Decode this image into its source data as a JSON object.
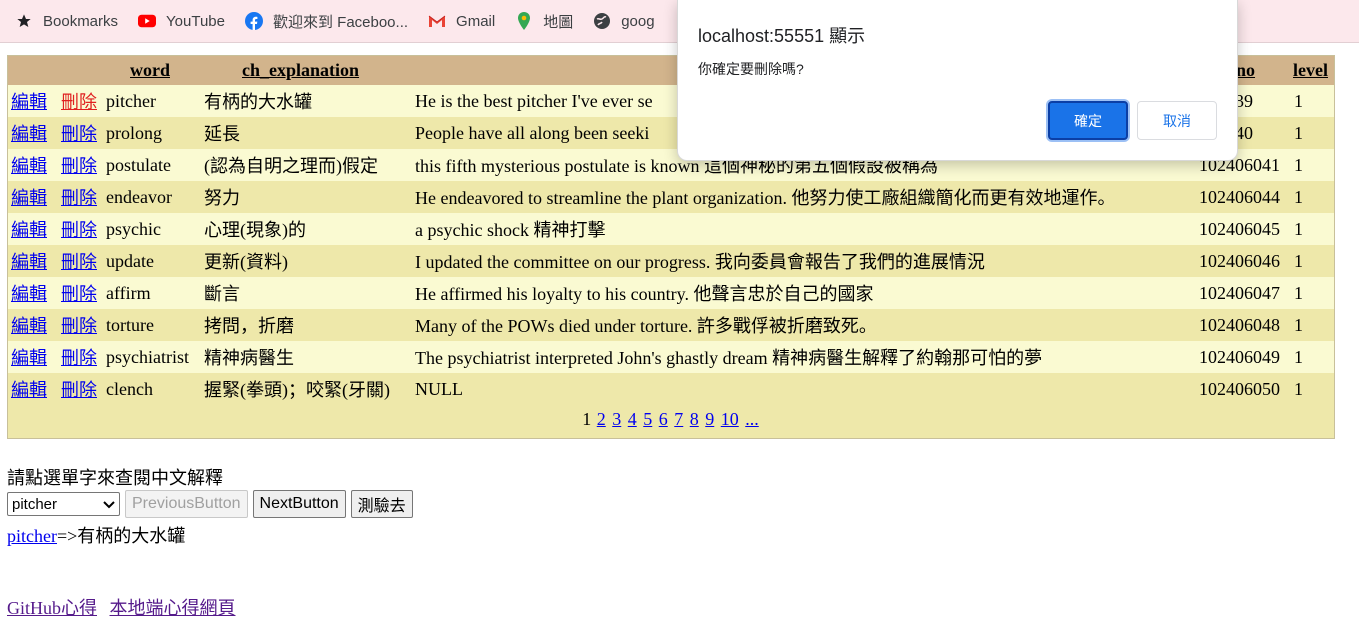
{
  "bookmarks": [
    {
      "label": "Bookmarks",
      "icon": "star-icon"
    },
    {
      "label": "YouTube",
      "icon": "youtube-icon"
    },
    {
      "label": "歡迎來到 Faceboo...",
      "icon": "facebook-icon"
    },
    {
      "label": "Gmail",
      "icon": "gmail-icon"
    },
    {
      "label": "地圖",
      "icon": "maps-icon"
    },
    {
      "label": "goog",
      "icon": "globe-icon"
    }
  ],
  "table": {
    "headers": {
      "word": "word",
      "ch_explanation": "ch_explanation",
      "no": "no",
      "level": "level"
    },
    "edit_label": "編輯",
    "delete_label": "刪除",
    "rows": [
      {
        "word": "pitcher",
        "ch": "有柄的大水罐",
        "sentence": "He is the best pitcher I've ever se",
        "no": "406039",
        "level": "1"
      },
      {
        "word": "prolong",
        "ch": "延長",
        "sentence": "People have all along been seeki",
        "no": "406040",
        "level": "1"
      },
      {
        "word": "postulate",
        "ch": "(認為自明之理而)假定",
        "sentence": "this fifth mysterious postulate is known 這個神秘的第五個假設被稱為",
        "no": "102406041",
        "level": "1"
      },
      {
        "word": "endeavor",
        "ch": "努力",
        "sentence": "He endeavored to streamline the plant organization. 他努力使工廠組織簡化而更有效地運作。",
        "no": "102406044",
        "level": "1"
      },
      {
        "word": "psychic",
        "ch": "心理(現象)的",
        "sentence": "a psychic shock 精神打擊",
        "no": "102406045",
        "level": "1"
      },
      {
        "word": "update",
        "ch": "更新(資料)",
        "sentence": "I updated the committee on our progress. 我向委員會報告了我們的進展情況",
        "no": "102406046",
        "level": "1"
      },
      {
        "word": "affirm",
        "ch": "斷言",
        "sentence": "He affirmed his loyalty to his country. 他聲言忠於自己的國家",
        "no": "102406047",
        "level": "1"
      },
      {
        "word": "torture",
        "ch": "拷問，折磨",
        "sentence": "Many of the POWs died under torture. 許多戰俘被折磨致死。",
        "no": "102406048",
        "level": "1"
      },
      {
        "word": "psychiatrist",
        "ch": "精神病醫生",
        "sentence": "The psychiatrist interpreted John's ghastly dream 精神病醫生解釋了約翰那可怕的夢",
        "no": "102406049",
        "level": "1"
      },
      {
        "word": "clench",
        "ch": "握緊(拳頭)；咬緊(牙關)",
        "sentence": "NULL",
        "no": "102406050",
        "level": "1"
      }
    ],
    "pager": {
      "current": "1",
      "pages": [
        "2",
        "3",
        "4",
        "5",
        "6",
        "7",
        "8",
        "9",
        "10",
        "..."
      ]
    }
  },
  "prompt": "請點選單字來查閱中文解釋",
  "controls": {
    "select_value": "pitcher",
    "prev": "PreviousButton",
    "next": "NextButton",
    "quiz": "測驗去"
  },
  "result": {
    "word": "pitcher",
    "arrow_text": "=>有柄的大水罐"
  },
  "footer": {
    "github": "GitHub心得",
    "local": "本地端心得網頁"
  },
  "dialog": {
    "title": "localhost:55551 顯示",
    "message": "你確定要刪除嗎?",
    "ok": "確定",
    "cancel": "取消"
  },
  "colors": {
    "header_bg": "#d2b48c",
    "row_odd": "#fafad2",
    "row_even": "#eee8aa",
    "dialog_ok": "#1a73e8"
  }
}
